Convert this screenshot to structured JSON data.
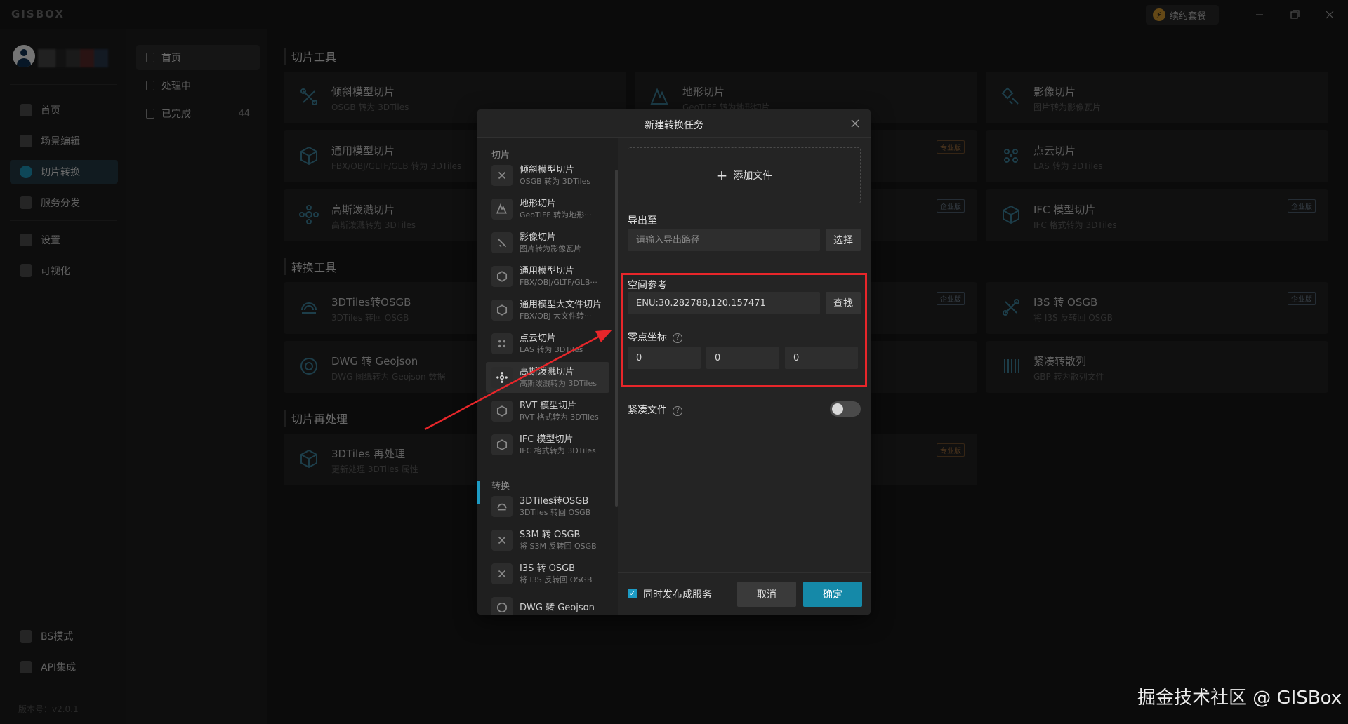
{
  "app": {
    "logo": "GISBOX",
    "renew_label": "续约套餐"
  },
  "sidebar": {
    "items": [
      {
        "label": "首页",
        "icon": "home-icon"
      },
      {
        "label": "场景编辑",
        "icon": "cube-icon"
      },
      {
        "label": "切片转换",
        "icon": "convert-icon",
        "active": true
      },
      {
        "label": "服务分发",
        "icon": "upload-icon"
      },
      {
        "label": "设置",
        "icon": "gear-icon"
      },
      {
        "label": "可视化",
        "icon": "visual-icon"
      },
      {
        "label": "BS模式",
        "icon": "code-icon"
      },
      {
        "label": "API集成",
        "icon": "link-icon"
      }
    ],
    "version": "版本号：v2.0.1"
  },
  "subnav": {
    "items": [
      {
        "label": "首页",
        "active": true
      },
      {
        "label": "处理中"
      },
      {
        "label": "已完成",
        "count": "44"
      }
    ]
  },
  "main": {
    "sections": [
      "切片工具",
      "转换工具",
      "切片再处理"
    ],
    "cards": [
      {
        "title": "倾斜模型切片",
        "sub": "OSGB 转为 3DTiles"
      },
      {
        "title": "地形切片",
        "sub": "GeoTIFF 转为地形切片"
      },
      {
        "title": "影像切片",
        "sub": "图片转为影像瓦片"
      },
      {
        "title": "通用模型切片",
        "sub": "FBX/OBJ/GLTF/GLB 转为 3DTiles"
      },
      {
        "title": "点云切片",
        "sub": "LAS 转为 3DTiles"
      },
      {
        "title": "高斯泼溅切片",
        "sub": "高斯泼溅转为 3DTiles"
      },
      {
        "title": "IFC 模型切片",
        "sub": "IFC 格式转为 3DTiles"
      },
      {
        "title": "3DTiles转OSGB",
        "sub": "3DTiles 转回 OSGB"
      },
      {
        "title": "I3S 转 OSGB",
        "sub": "将 I3S 反转回 OSGB"
      },
      {
        "title": "DWG 转 Geojson",
        "sub": "DWG 图纸转为 Geojson 数据"
      },
      {
        "title": "紧凑转散列",
        "sub": "GBP 转为散列文件"
      },
      {
        "title": "3DTiles 再处理",
        "sub": "更新处理 3DTiles 属性"
      }
    ],
    "badge_pro": "专业版",
    "badge_ent": "企业版"
  },
  "modal": {
    "title": "新建转换任务",
    "group_slice": "切片",
    "group_convert": "转换",
    "list": [
      {
        "title": "倾斜模型切片",
        "sub": "OSGB 转为 3DTiles"
      },
      {
        "title": "地形切片",
        "sub": "GeoTIFF 转为地形···"
      },
      {
        "title": "影像切片",
        "sub": "图片转为影像瓦片"
      },
      {
        "title": "通用模型切片",
        "sub": "FBX/OBJ/GLTF/GLB···"
      },
      {
        "title": "通用模型大文件切片",
        "sub": "FBX/OBJ 大文件转···"
      },
      {
        "title": "点云切片",
        "sub": "LAS 转为 3DTiles"
      },
      {
        "title": "高斯泼溅切片",
        "sub": "高斯泼溅转为 3DTiles"
      },
      {
        "title": "RVT 模型切片",
        "sub": "RVT 格式转为 3DTiles"
      },
      {
        "title": "IFC 模型切片",
        "sub": "IFC 格式转为 3DTiles"
      },
      {
        "title": "3DTiles转OSGB",
        "sub": "3DTiles 转回 OSGB"
      },
      {
        "title": "S3M 转 OSGB",
        "sub": "将 S3M 反转回 OSGB"
      },
      {
        "title": "I3S 转 OSGB",
        "sub": "将 I3S 反转回 OSGB"
      },
      {
        "title": "DWG 转 Geojson",
        "sub": ""
      }
    ],
    "add_file": "添加文件",
    "export_label": "导出至",
    "export_placeholder": "请输入导出路径",
    "export_btn": "选择",
    "spatial_label": "空间参考",
    "spatial_value": "ENU:30.282788,120.157471",
    "spatial_btn": "查找",
    "origin_label": "零点坐标",
    "origin_x": "0",
    "origin_y": "0",
    "origin_z": "0",
    "compact_label": "紧凑文件",
    "compact_on": false,
    "publish_label": "同时发布成服务",
    "publish_checked": true,
    "cancel": "取消",
    "ok": "确定"
  },
  "watermark": "掘金技术社区 @ GISBox",
  "colors": {
    "accent": "#1589a8",
    "highlight": "#e8262a",
    "active_nav": "#233640"
  }
}
